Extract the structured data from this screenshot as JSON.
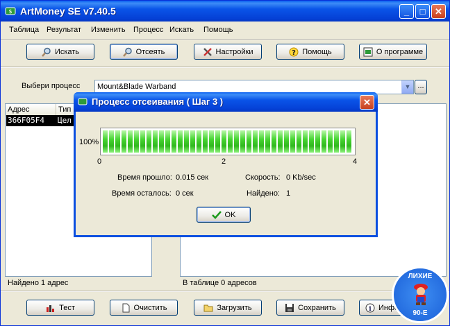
{
  "window": {
    "title": "ArtMoney SE v7.40.5"
  },
  "menu": [
    "Таблица",
    "Результат",
    "Изменить",
    "Процесс",
    "Искать",
    "Помощь"
  ],
  "toolbar": {
    "search": "Искать",
    "filter": "Отсеять",
    "settings": "Настройки",
    "help": "Помощь",
    "about": "О программе"
  },
  "process": {
    "label": "Выбери процесс",
    "value": "Mount&Blade Warband",
    "browse": "..."
  },
  "left_table": {
    "headers": [
      "Адрес",
      "Тип"
    ],
    "rows": [
      {
        "address": "366F05F4",
        "type": "Цел"
      }
    ],
    "status": "Найдено 1 адрес"
  },
  "right_table": {
    "status": "В таблице 0 адресов"
  },
  "bottom_buttons": {
    "test": "Тест",
    "clear": "Очистить",
    "load": "Загрузить",
    "save": "Сохранить",
    "info": "Инфо"
  },
  "dialog": {
    "title": "Процесс отсеивания ( Шаг 3 )",
    "percent": "100%",
    "progress_fraction": 1.0,
    "scale": [
      "0",
      "2",
      "4"
    ],
    "elapsed_label": "Время прошло:",
    "elapsed_value": "0.015 сек",
    "remaining_label": "Время осталось:",
    "remaining_value": "0 сек",
    "speed_label": "Скорость:",
    "speed_value": "0 Kb/sec",
    "found_label": "Найдено:",
    "found_value": "1",
    "ok": "OK"
  },
  "watermark": {
    "top": "ЛИХИЕ",
    "bottom": "90-Е"
  },
  "colors": {
    "titlebar": "#0a54e8",
    "progress": "#2fb81e",
    "face": "#ece9d8"
  }
}
